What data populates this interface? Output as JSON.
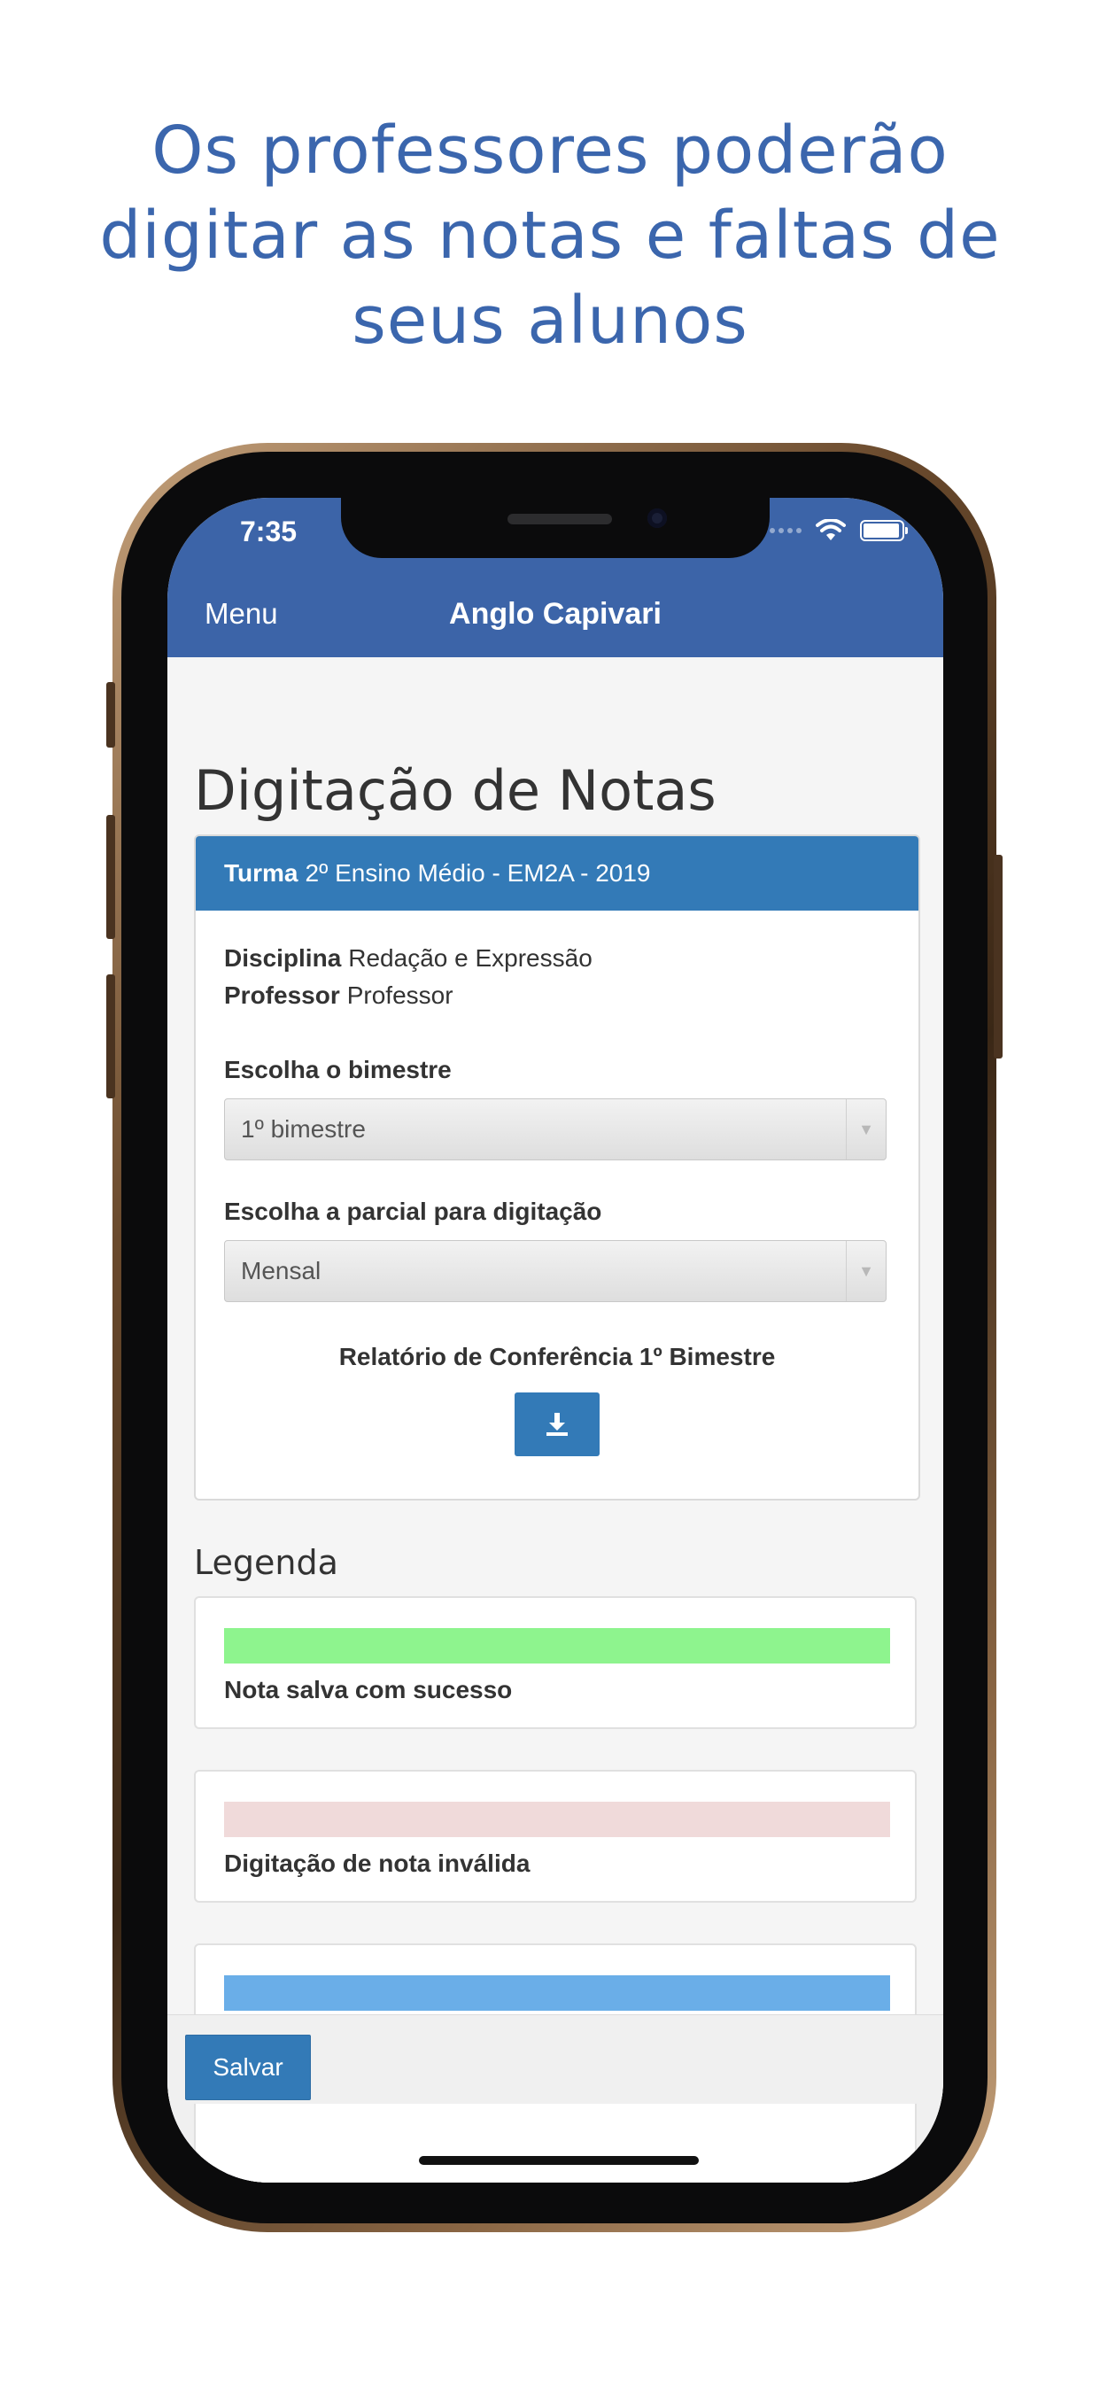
{
  "promo": {
    "headline_line1": "Os professores poderão",
    "headline_line2": "digitar as notas e faltas de",
    "headline_line3": "seus alunos"
  },
  "status_bar": {
    "time": "7:35",
    "icons": [
      "signal-dots-icon",
      "wifi-icon",
      "battery-icon"
    ]
  },
  "nav": {
    "menu_label": "Menu",
    "title": "Anglo Capivari"
  },
  "page": {
    "title": "Digitação de Notas"
  },
  "panel": {
    "turma_label": "Turma",
    "turma_value": "2º Ensino Médio - EM2A - 2019",
    "disciplina_label": "Disciplina",
    "disciplina_value": "Redação e Expressão",
    "professor_label": "Professor",
    "professor_value": "Professor",
    "bimestre_label": "Escolha o bimestre",
    "bimestre_selected": "1º bimestre",
    "parcial_label": "Escolha a parcial para digitação",
    "parcial_selected": "Mensal",
    "report_label": "Relatório de Conferência 1º Bimestre",
    "download_icon": "download-icon"
  },
  "legend": {
    "title": "Legenda",
    "items": [
      {
        "label": "Nota salva com sucesso",
        "color": "#8ef48e"
      },
      {
        "label": "Digitação de nota inválida",
        "color": "#f0dada"
      },
      {
        "label": "",
        "color": "#6aaee8"
      }
    ]
  },
  "footer": {
    "save_label": "Salvar"
  },
  "colors": {
    "brand_blue": "#3c64a8",
    "button_blue": "#337ab7",
    "headline_blue": "#3b66ad"
  }
}
